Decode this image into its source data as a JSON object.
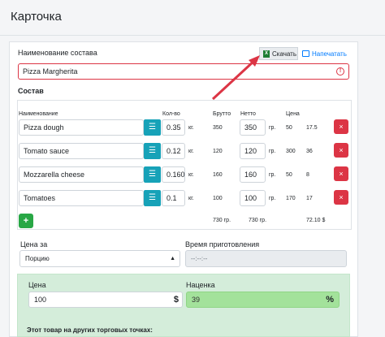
{
  "header": {
    "title": "Карточка"
  },
  "form": {
    "name_label": "Наименование состава",
    "download_label": "Скачать",
    "print_label": "Напечатать",
    "name_value": "Pizza Margherita",
    "err_icon": "!"
  },
  "composition": {
    "title": "Состав",
    "headers": {
      "name": "Наименование",
      "qty": "Кол-во",
      "gross": "Брутто",
      "net": "Нетто",
      "price": "Цена"
    },
    "rows": [
      {
        "name": "Pizza dough",
        "qty": "0.35",
        "unit": "кг.",
        "gross": "350",
        "net": "350",
        "net_unit": "гр.",
        "col5": "50",
        "col6": "17.5"
      },
      {
        "name": "Tomato sauce",
        "qty": "0.12",
        "unit": "кг.",
        "gross": "120",
        "net": "120",
        "net_unit": "гр.",
        "col5": "300",
        "col6": "36"
      },
      {
        "name": "Mozzarella cheese",
        "qty": "0.160",
        "unit": "кг.",
        "gross": "160",
        "net": "160",
        "net_unit": "гр.",
        "col5": "50",
        "col6": "8"
      },
      {
        "name": "Tomatoes",
        "qty": "0.1",
        "unit": "кг.",
        "gross": "100",
        "net": "100",
        "net_unit": "гр.",
        "col5": "170",
        "col6": "17"
      }
    ],
    "total_gross": "730 гр.",
    "total_net": "730 гр.",
    "total_price": "72.10 $",
    "add_label": "+",
    "delete_label": "×",
    "list_icon": "☰"
  },
  "pricing": {
    "price_for_label": "Цена за",
    "price_for_value": "Порцию",
    "cook_time_label": "Время приготовления",
    "cook_time_value": "--:--:--",
    "price_label": "Цена",
    "price_value": "100",
    "currency": "$",
    "markup_label": "Наценка",
    "markup_value": "39",
    "percent": "%",
    "other_label": "Этот товар на других торговых точках:"
  },
  "colors": {
    "danger": "#dc3545",
    "info": "#17a2b8",
    "success": "#28a745",
    "link": "#007bff"
  }
}
